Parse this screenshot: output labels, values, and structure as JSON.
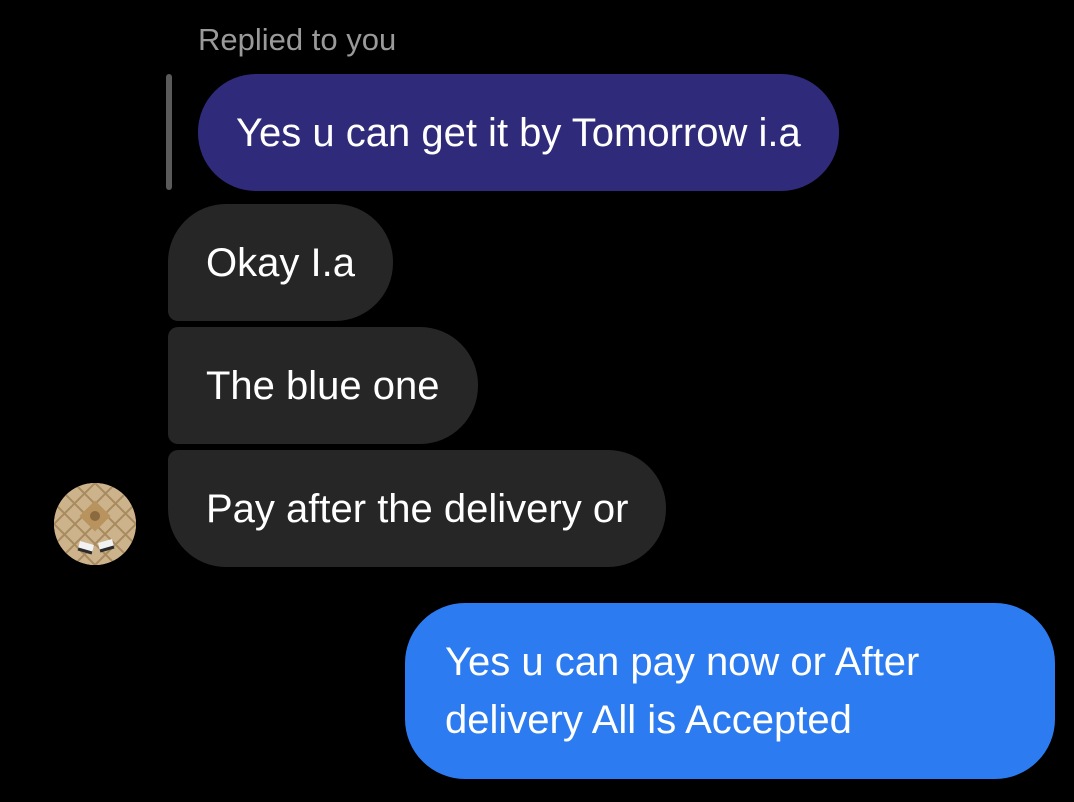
{
  "thread": {
    "replied_label": "Replied to you",
    "quoted_message": "Yes u can get it by Tomorrow i.a",
    "incoming_messages": [
      "Okay I.a",
      "The blue one",
      "Pay after the delivery or"
    ],
    "outgoing_message": "Yes u can pay now or After delivery All is Accepted"
  },
  "contact": {
    "avatar_icon": "contact-avatar"
  },
  "colors": {
    "background": "#000000",
    "quoted_bubble": "#2f2b7a",
    "incoming_bubble": "#262626",
    "outgoing_bubble": "#2c7bf0",
    "meta_text": "#9a9a9a"
  }
}
